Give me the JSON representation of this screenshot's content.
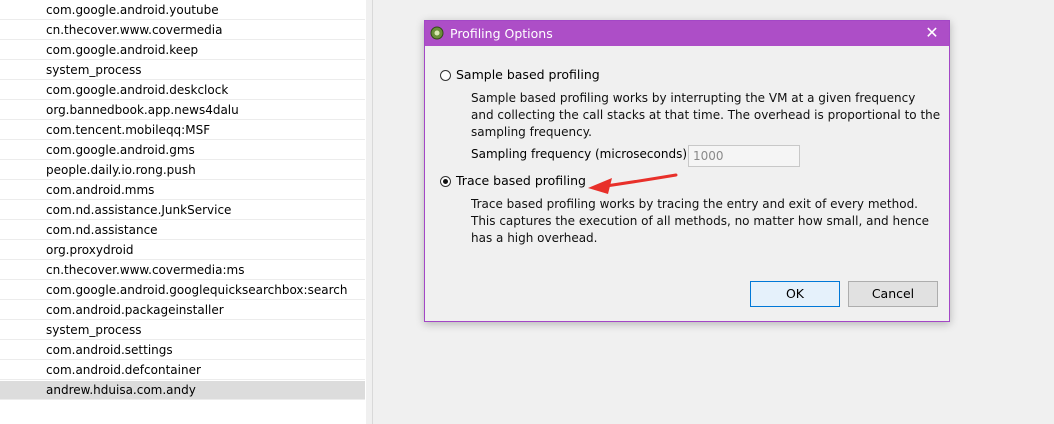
{
  "process_list": [
    "com.google.android.youtube",
    "cn.thecover.www.covermedia",
    "com.google.android.keep",
    "system_process",
    "com.google.android.deskclock",
    "org.bannedbook.app.news4dalu",
    "com.tencent.mobileqq:MSF",
    "com.google.android.gms",
    "people.daily.io.rong.push",
    "com.android.mms",
    "com.nd.assistance.JunkService",
    "com.nd.assistance",
    "org.proxydroid",
    "cn.thecover.www.covermedia:ms",
    "com.google.android.googlequicksearchbox:search",
    "com.android.packageinstaller",
    "system_process",
    "com.android.settings",
    "com.android.defcontainer",
    "andrew.hduisa.com.andy"
  ],
  "selected_process_index": 19,
  "dialog": {
    "title": "Profiling Options",
    "close_glyph": "✕",
    "sample": {
      "label": "Sample based profiling",
      "selected": false,
      "description": "Sample based profiling works by interrupting the VM at a given frequency and collecting the call stacks at that time. The overhead is proportional to the sampling frequency.",
      "frequency_label": "Sampling frequency (microseconds):",
      "frequency_value": "1000"
    },
    "trace": {
      "label": "Trace based profiling",
      "selected": true,
      "description": "Trace based profiling works by tracing the entry and exit of every method. This captures the execution of all methods, no matter how small, and hence has a high overhead."
    },
    "buttons": {
      "ok": "OK",
      "cancel": "Cancel"
    }
  },
  "colors": {
    "titlebar": "#ad4ec7",
    "annotation_arrow": "#e8302a"
  }
}
